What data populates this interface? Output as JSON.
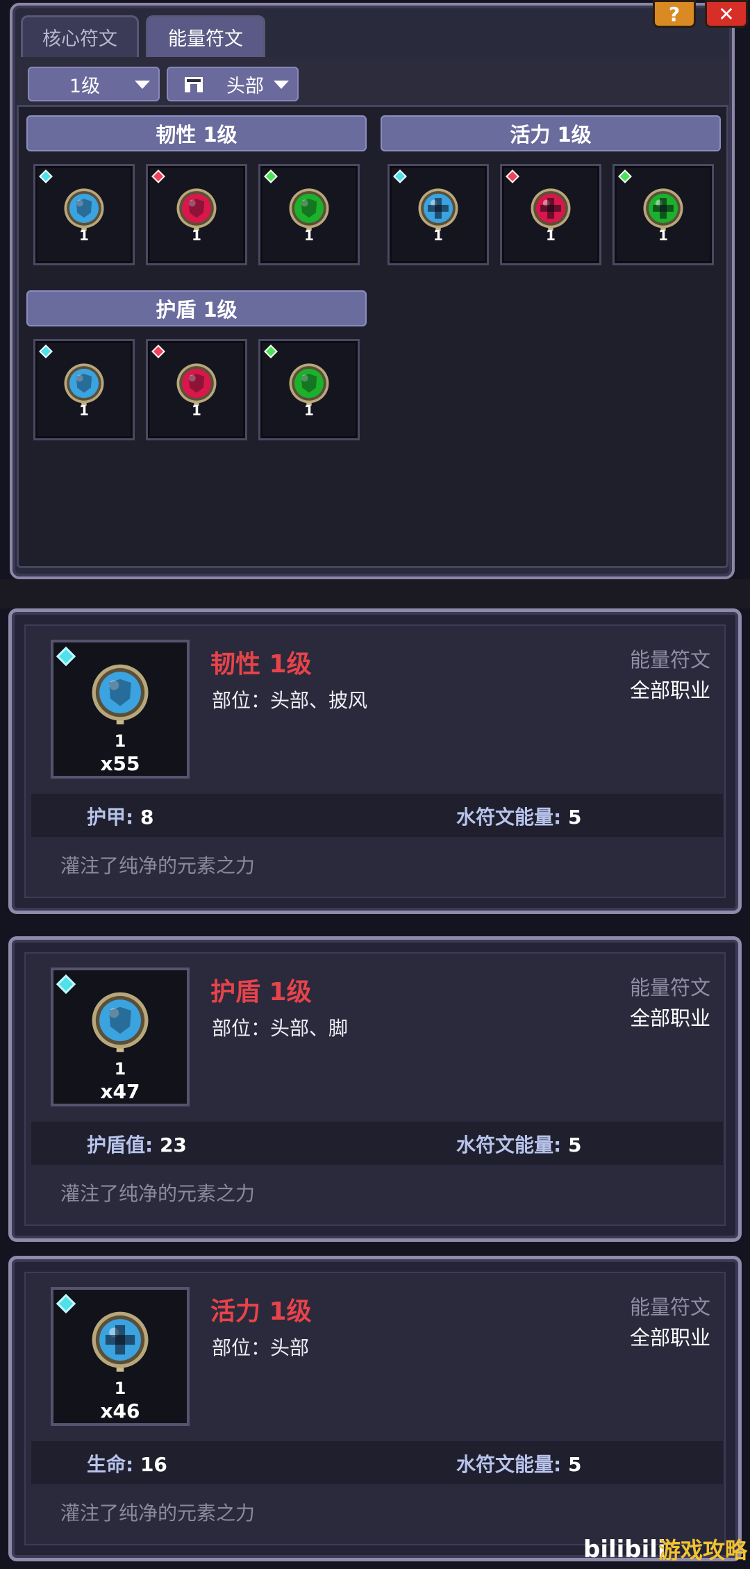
{
  "window": {
    "help_label": "?",
    "close_label": "✕",
    "tabs": [
      {
        "label": "核心符文",
        "active": false
      },
      {
        "label": "能量符文",
        "active": true
      }
    ],
    "filters": {
      "level": "1级",
      "part": "头部",
      "part_icon": "helmet-icon"
    }
  },
  "groups": [
    {
      "title": "韧性 1级",
      "runes": [
        {
          "color": "blue",
          "level": "1"
        },
        {
          "color": "red",
          "level": "1"
        },
        {
          "color": "green",
          "level": "1"
        }
      ]
    },
    {
      "title": "活力 1级",
      "runes": [
        {
          "color": "blue",
          "level": "1"
        },
        {
          "color": "red",
          "level": "1"
        },
        {
          "color": "green",
          "level": "1"
        }
      ]
    },
    {
      "title": "护盾 1级",
      "runes": [
        {
          "color": "blue",
          "level": "1"
        },
        {
          "color": "red",
          "level": "1"
        },
        {
          "color": "green",
          "level": "1"
        }
      ]
    }
  ],
  "cards": [
    {
      "name": "韧性 1级",
      "part": "部位：头部、披风",
      "type": "能量符文",
      "class": "全部职业",
      "level": "1",
      "count": "x55",
      "stat_label": "护甲: ",
      "stat_value": "8",
      "energy_label": "水符文能量: ",
      "energy_value": "5",
      "flavor": "灌注了纯净的元素之力"
    },
    {
      "name": "护盾 1级",
      "part": "部位：头部、脚",
      "type": "能量符文",
      "class": "全部职业",
      "level": "1",
      "count": "x47",
      "stat_label": "护盾值: ",
      "stat_value": "23",
      "energy_label": "水符文能量: ",
      "energy_value": "5",
      "flavor": "灌注了纯净的元素之力"
    },
    {
      "name": "活力 1级",
      "part": "部位：头部",
      "type": "能量符文",
      "class": "全部职业",
      "level": "1",
      "count": "x46",
      "stat_label": "生命: ",
      "stat_value": "16",
      "energy_label": "水符文能量: ",
      "energy_value": "5",
      "flavor": "灌注了纯净的元素之力"
    }
  ],
  "colors": {
    "blue": "#3aa3e0",
    "red": "#d8174a",
    "green": "#1bb12a",
    "name_red": "#e8434a"
  },
  "watermark": {
    "left": "bilibili",
    "right": "游戏攻略"
  }
}
